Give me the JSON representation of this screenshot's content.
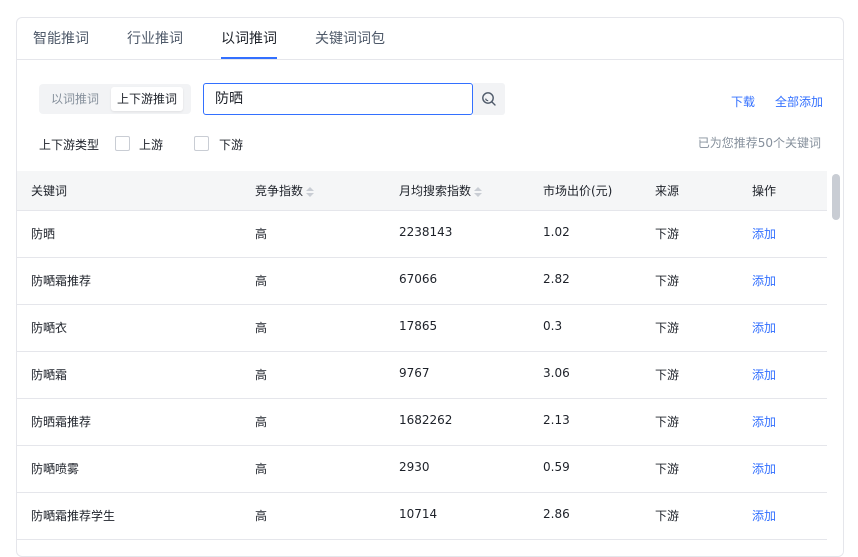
{
  "tabs": [
    {
      "label": "智能推词"
    },
    {
      "label": "行业推词"
    },
    {
      "label": "以词推词"
    },
    {
      "label": "关键词词包"
    }
  ],
  "mode_switch": {
    "options": [
      "以词推词",
      "上下游推词"
    ],
    "selected": "上下游推词"
  },
  "search": {
    "value": "防晒"
  },
  "actions": {
    "download": "下载",
    "add_all": "全部添加"
  },
  "filter": {
    "label": "上下游类型",
    "options": [
      "上游",
      "下游"
    ]
  },
  "hint": "已为您推荐50个关键词",
  "table": {
    "columns": [
      "关键词",
      "竞争指数",
      "月均搜索指数",
      "市场出价(元)",
      "来源",
      "操作"
    ],
    "rows": [
      {
        "keyword": "防晒",
        "competition": "高",
        "monthly_search": "2238143",
        "bid": "1.02",
        "source": "下游",
        "action": "添加"
      },
      {
        "keyword": "防嗮霜推荐",
        "competition": "高",
        "monthly_search": "67066",
        "bid": "2.82",
        "source": "下游",
        "action": "添加"
      },
      {
        "keyword": "防嗮衣",
        "competition": "高",
        "monthly_search": "17865",
        "bid": "0.3",
        "source": "下游",
        "action": "添加"
      },
      {
        "keyword": "防嗮霜",
        "competition": "高",
        "monthly_search": "9767",
        "bid": "3.06",
        "source": "下游",
        "action": "添加"
      },
      {
        "keyword": "防晒霜推荐",
        "competition": "高",
        "monthly_search": "1682262",
        "bid": "2.13",
        "source": "下游",
        "action": "添加"
      },
      {
        "keyword": "防嗮喷雾",
        "competition": "高",
        "monthly_search": "2930",
        "bid": "0.59",
        "source": "下游",
        "action": "添加"
      },
      {
        "keyword": "防嗮霜推荐学生",
        "competition": "高",
        "monthly_search": "10714",
        "bid": "2.86",
        "source": "下游",
        "action": "添加"
      }
    ]
  },
  "colors": {
    "accent": "#3370ff",
    "border": "#e5e6eb",
    "muted": "#86909c"
  }
}
